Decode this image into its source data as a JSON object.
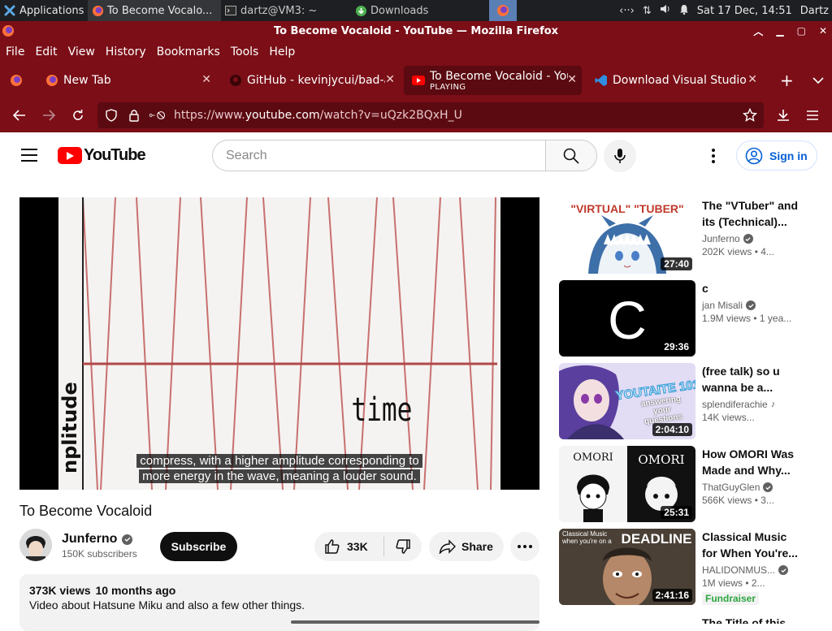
{
  "taskbar": {
    "applications": "Applications",
    "yt_window": "To Become Vocalo...",
    "terminal": "dartz@VM3: ~",
    "downloads": "Downloads",
    "clock": "Sat 17 Dec, 14:51",
    "user": "Dartz"
  },
  "window": {
    "title": "To Become Vocaloid - YouTube — Mozilla Firefox"
  },
  "menu": [
    "File",
    "Edit",
    "View",
    "History",
    "Bookmarks",
    "Tools",
    "Help"
  ],
  "tabs": [
    {
      "label": "New Tab"
    },
    {
      "label": "GitHub - kevinjycui/bad-a"
    },
    {
      "label": "To Become Vocaloid - You",
      "status": "PLAYING"
    },
    {
      "label": "Download Visual Studio C"
    }
  ],
  "address": {
    "prefix": "https://www.",
    "domain": "youtube.com",
    "path": "/watch?v=uQzk2BQxH_U"
  },
  "yt": {
    "logo_text": "YouTube",
    "search_placeholder": "Search",
    "signin": "Sign in"
  },
  "video": {
    "frame_text_time": "time",
    "frame_text_amplitude": "nplitude",
    "caption_line1": "compress, with a higher amplitude corresponding to",
    "caption_line2": "more energy in the wave, meaning a louder sound.",
    "title": "To Become Vocaloid",
    "channel": "Junferno",
    "subscribers": "150K subscribers",
    "subscribe": "Subscribe",
    "likes": "33K",
    "share": "Share",
    "views": "373K views",
    "age": "10 months ago",
    "description": "Video about Hatsune Miku and also a few other things."
  },
  "recommendations": [
    {
      "title": "The \"VTuber\" and its (Technical)...",
      "channel": "Junferno",
      "views": "202K views • 4...",
      "duration": "27:40",
      "thumb_text": "\"VIRTUAL\" \"TUBER\"",
      "verified": true
    },
    {
      "title": "c",
      "channel": "jan Misali",
      "views": "1.9M views • 1 yea...",
      "duration": "29:36",
      "thumb_text": "C",
      "verified": true
    },
    {
      "title": "(free talk) so u wanna be a...",
      "channel": "splendiferachie",
      "views": "14K views...",
      "duration": "2:04:10",
      "thumb_text": "YOUTAITE 101",
      "thumb_sub": "answering your questions",
      "music": true
    },
    {
      "title": "How OMORI Was Made and Why...",
      "channel": "ThatGuyGlen",
      "views": "566K views • 3...",
      "duration": "25:31",
      "thumb_text": "OMORI",
      "verified": true
    },
    {
      "title": "Classical Music for When You're...",
      "channel": "HALIDONMUS...",
      "views": "1M views • 2...",
      "duration": "2:41:16",
      "thumb_text": "DEADLINE",
      "thumb_sub": "Classical Music when you're on a",
      "badge": "Fundraiser",
      "verified": true
    },
    {
      "title": "The Title of this",
      "channel": "",
      "views": "",
      "duration": ""
    }
  ],
  "colors": {
    "firefox_chrome": "#7b0e17",
    "yt_red": "#ff0000",
    "signin_blue": "#065fd4"
  }
}
